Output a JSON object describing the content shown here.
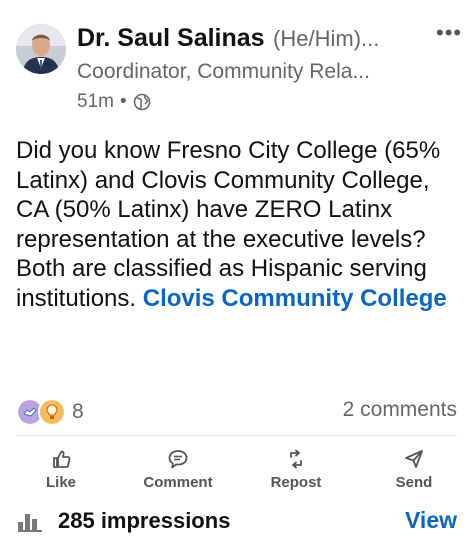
{
  "author": {
    "name": "Dr. Saul Salinas",
    "pronouns": "(He/Him)...",
    "headline": "Coordinator, Community Rela...",
    "time": "51m",
    "visibility_icon": "globe-icon"
  },
  "more_icon": "ellipsis-icon",
  "post": {
    "text": "Did you know Fresno City College (65% Latinx) and Clovis Community College, CA (50% Latinx) have ZERO Latinx representation at the executive levels?",
    "text2": "Both are classified as Hispanic serving institutions.",
    "mention": "Clovis Community College"
  },
  "social": {
    "reaction_count": "8",
    "reaction_icons": [
      "support-icon",
      "insightful-icon"
    ],
    "comments": "2 comments"
  },
  "actions": {
    "like": "Like",
    "comment": "Comment",
    "repost": "Repost",
    "send": "Send"
  },
  "footer": {
    "impressions": "285 impressions",
    "view": "View"
  },
  "colors": {
    "accent": "#0a66c2",
    "support": "#b9a4e0",
    "insightful": "#f5bb5c"
  }
}
